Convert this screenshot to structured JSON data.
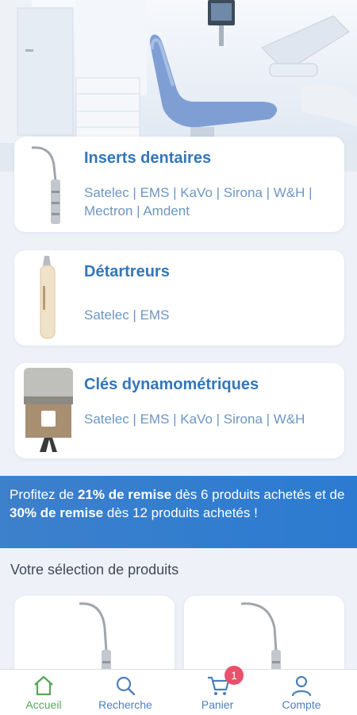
{
  "categories": [
    {
      "title": "Inserts dentaires",
      "brands": "Satelec | EMS | KaVo | Sirona | W&H | Mectron | Amdent"
    },
    {
      "title": "Détartreurs",
      "brands": "Satelec | EMS"
    },
    {
      "title": "Clés dynamométriques",
      "brands": "Satelec | EMS | KaVo | Sirona | W&H"
    }
  ],
  "promo": {
    "part1": "Profitez de ",
    "bold1": "21% de remise",
    "part2": " dès 6 produits achetés et de ",
    "bold2": "30% de remise",
    "part3": " dès 12 produits achetés !"
  },
  "section_title": "Votre sélection de produits",
  "nav": {
    "home": "Accueil",
    "search": "Recherche",
    "cart": "Panier",
    "cart_count": "1",
    "account": "Compte"
  },
  "colors": {
    "accent": "#3476b8",
    "brand_text": "#6d96c3",
    "promo_bg": "#2b7bd1",
    "nav_active": "#55a85a",
    "nav_inactive": "#4c7fbd",
    "badge": "#e9506b"
  },
  "icons": {
    "home": "home-icon",
    "search": "search-icon",
    "cart": "cart-icon",
    "account": "user-icon"
  }
}
